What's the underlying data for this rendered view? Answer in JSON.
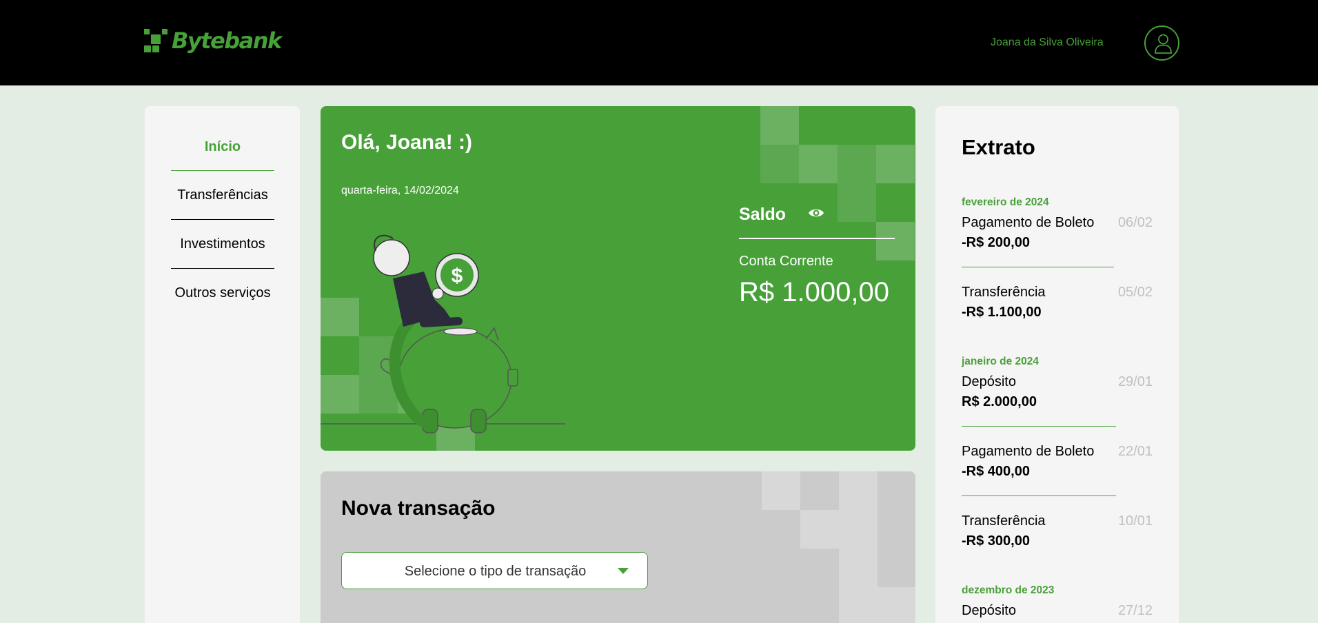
{
  "header": {
    "brand": "Bytebank",
    "user_name": "Joana da Silva Oliveira",
    "brand_color": "#47a138"
  },
  "sidebar": {
    "items": [
      {
        "label": "Início",
        "active": true
      },
      {
        "label": "Transferências",
        "active": false
      },
      {
        "label": "Investimentos",
        "active": false
      },
      {
        "label": "Outros serviços",
        "active": false
      }
    ]
  },
  "balance": {
    "greeting": "Olá, Joana! :)",
    "date": "quarta-feira, 14/02/2024",
    "title": "Saldo",
    "account_label": "Conta Corrente",
    "amount": "R$ 1.000,00"
  },
  "new_transaction": {
    "title": "Nova transação",
    "select_placeholder": "Selecione o tipo de transação"
  },
  "statement": {
    "title": "Extrato",
    "months": [
      "fevereiro de 2024",
      "janeiro de 2024",
      "dezembro de 2023"
    ],
    "entries": [
      {
        "type": "Pagamento de Boleto",
        "date": "06/02",
        "amount": "-R$ 200,00"
      },
      {
        "type": "Transferência",
        "date": "05/02",
        "amount": "-R$ 1.100,00"
      },
      {
        "type": "Depósito",
        "date": "29/01",
        "amount": "R$ 2.000,00"
      },
      {
        "type": "Pagamento de Boleto",
        "date": "22/01",
        "amount": "-R$ 400,00"
      },
      {
        "type": "Transferência",
        "date": "10/01",
        "amount": "-R$ 300,00"
      },
      {
        "type": "Depósito",
        "date": "27/12",
        "amount": ""
      }
    ]
  }
}
